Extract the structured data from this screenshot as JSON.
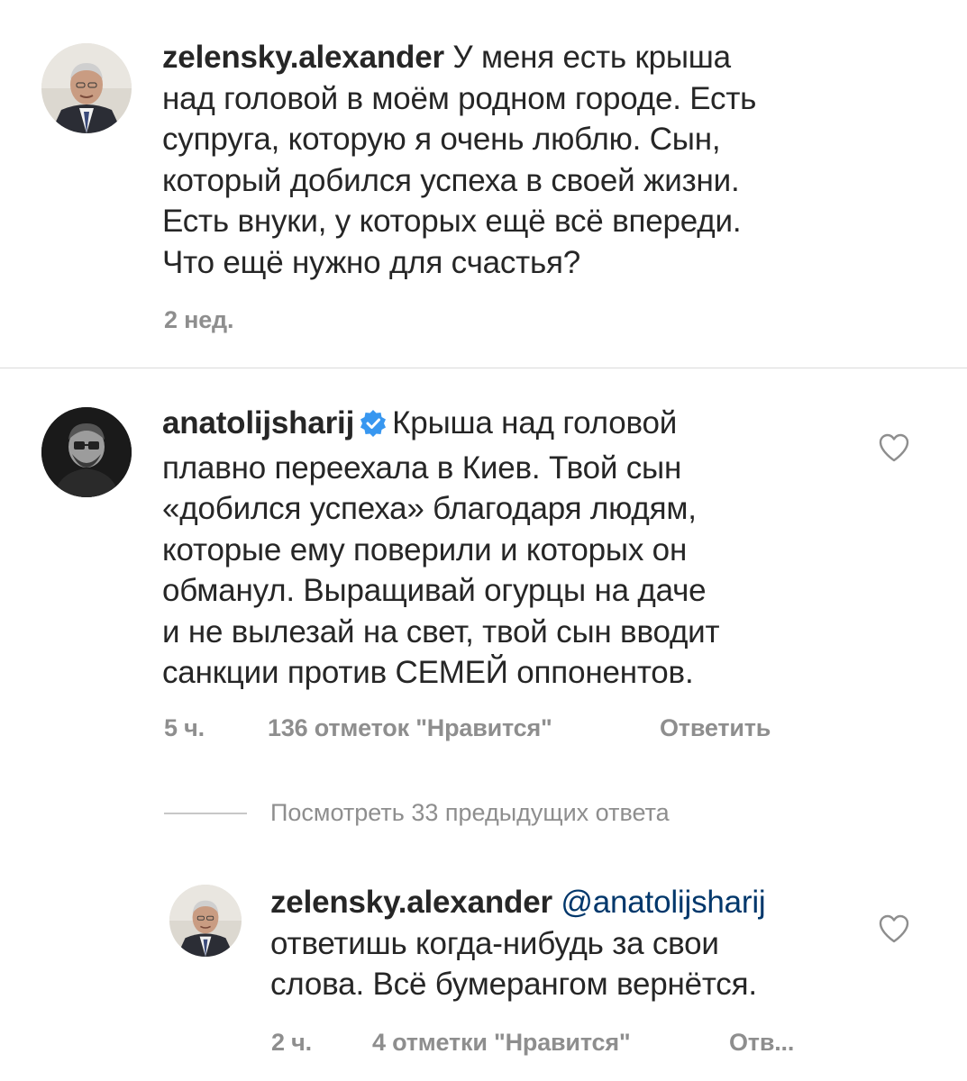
{
  "comments": [
    {
      "username": "zelensky.alexander",
      "text_lines": [
        "У меня есть крыша",
        "над головой в моём родном городе. Есть",
        "супруга, которую я очень люблю. Сын,",
        "который добился успеха в своей жизни.",
        "Есть внуки, у которых ещё всё впереди.",
        "Что ещё нужно для счастья?"
      ],
      "time": "2 нед."
    },
    {
      "username": "anatolijsharij",
      "verified": true,
      "text_lines": [
        "Крыша над головой",
        "плавно переехала в Киев. Твой сын",
        "«добился успеха» благодаря людям,",
        "которые ему поверили и которых он",
        "обманул. Выращивай огурцы на даче",
        "и не вылезай на свет, твой сын вводит",
        "санкции против СЕМЕЙ оппонентов."
      ],
      "time": "5 ч.",
      "likes": "136 отметок \"Нравится\"",
      "reply": "Ответить"
    }
  ],
  "view_replies": "Посмотреть 33 предыдущих ответа",
  "reply_comment": {
    "username": "zelensky.alexander",
    "mention": "@anatolijsharij",
    "text_lines": [
      "ответишь когда-нибудь за свои",
      "слова. Всё бумерангом вернётся."
    ],
    "time": "2 ч.",
    "likes": "4 отметки \"Нравится\"",
    "reply": "Отв..."
  },
  "colors": {
    "text": "#262626",
    "meta": "#8e8e8e",
    "mention": "#00376b",
    "verified": "#3897f0"
  },
  "icons": [
    "avatar-photo",
    "verified-badge-icon",
    "heart-outline-icon"
  ]
}
